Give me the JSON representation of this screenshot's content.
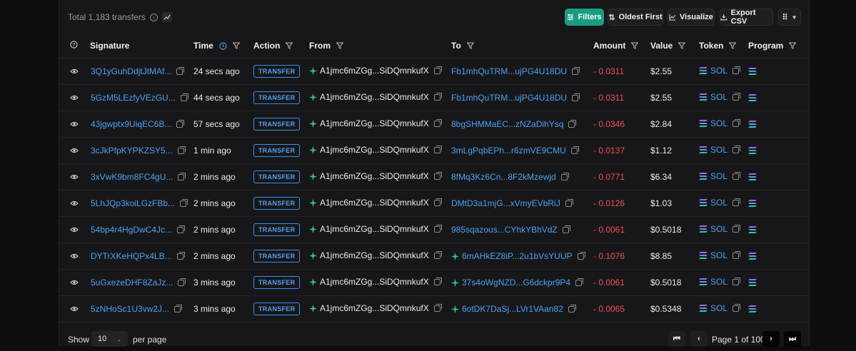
{
  "header": {
    "total_label": "Total 1,183 transfers",
    "filters_label": "Filters",
    "sort_label": "Oldest First",
    "visualize_label": "Visualize",
    "export_label": "Export CSV"
  },
  "columns": {
    "signature": "Signature",
    "time": "Time",
    "action": "Action",
    "from": "From",
    "to": "To",
    "amount": "Amount",
    "value": "Value",
    "token": "Token",
    "program": "Program"
  },
  "rows": [
    {
      "signature": "3Q1yGuhDdjtJtMAf...",
      "time": "24 secs ago",
      "action": "TRANSFER",
      "from": "A1jmc6mZGg...SiDQmnkufX",
      "to": "Fb1mhQuTRM...ujPG4U18DU",
      "to_has_icon": false,
      "amount": "- 0.0311",
      "value": "$2.55",
      "token": "SOL"
    },
    {
      "signature": "5GzM5LEzfyVEzGU...",
      "time": "44 secs ago",
      "action": "TRANSFER",
      "from": "A1jmc6mZGg...SiDQmnkufX",
      "to": "Fb1mhQuTRM...ujPG4U18DU",
      "to_has_icon": false,
      "amount": "- 0.0311",
      "value": "$2.55",
      "token": "SOL"
    },
    {
      "signature": "43jgwptx9UiqEC6B...",
      "time": "57 secs ago",
      "action": "TRANSFER",
      "from": "A1jmc6mZGg...SiDQmnkufX",
      "to": "8bgSHMMaEC...zNZaDihYsq",
      "to_has_icon": false,
      "amount": "- 0.0346",
      "value": "$2.84",
      "token": "SOL"
    },
    {
      "signature": "3cJkPfpKYPKZSY5...",
      "time": "1 min ago",
      "action": "TRANSFER",
      "from": "A1jmc6mZGg...SiDQmnkufX",
      "to": "3mLgPqbEPh...r6zmVE9CMU",
      "to_has_icon": false,
      "amount": "- 0.0137",
      "value": "$1.12",
      "token": "SOL"
    },
    {
      "signature": "3xVwK9bm8FC4gU...",
      "time": "2 mins ago",
      "action": "TRANSFER",
      "from": "A1jmc6mZGg...SiDQmnkufX",
      "to": "8fMq3Kz6Cn...8F2kMzewjd",
      "to_has_icon": false,
      "amount": "- 0.0771",
      "value": "$6.34",
      "token": "SOL"
    },
    {
      "signature": "5LhJQp3koiLGzFBb...",
      "time": "2 mins ago",
      "action": "TRANSFER",
      "from": "A1jmc6mZGg...SiDQmnkufX",
      "to": "DMtD3a1mjG...xVmyEVbRiJ",
      "to_has_icon": false,
      "amount": "- 0.0126",
      "value": "$1.03",
      "token": "SOL"
    },
    {
      "signature": "54bp4r4HgDwC4Jc...",
      "time": "2 mins ago",
      "action": "TRANSFER",
      "from": "A1jmc6mZGg...SiDQmnkufX",
      "to": "985sqazous...CYhkYBhVdZ",
      "to_has_icon": false,
      "amount": "- 0.0061",
      "value": "$0.5018",
      "token": "SOL"
    },
    {
      "signature": "DYTrXKeHQPx4LB...",
      "time": "2 mins ago",
      "action": "TRANSFER",
      "from": "A1jmc6mZGg...SiDQmnkufX",
      "to": "6mAHkEZ8iP...2u1bVsYUUP",
      "to_has_icon": true,
      "amount": "- 0.1076",
      "value": "$8.85",
      "token": "SOL"
    },
    {
      "signature": "5uGxezeDHF8ZaJz...",
      "time": "3 mins ago",
      "action": "TRANSFER",
      "from": "A1jmc6mZGg...SiDQmnkufX",
      "to": "37s4oWgNZD...G6dckpr9P4",
      "to_has_icon": true,
      "amount": "- 0.0061",
      "value": "$0.5018",
      "token": "SOL"
    },
    {
      "signature": "5zNHoSc1U3vw2J...",
      "time": "3 mins ago",
      "action": "TRANSFER",
      "from": "A1jmc6mZGg...SiDQmnkufX",
      "to": "6otDK7DaSj...LVr1VAan82",
      "to_has_icon": true,
      "amount": "- 0.0065",
      "value": "$0.5348",
      "token": "SOL"
    }
  ],
  "footer": {
    "show_label": "Show",
    "page_size": "10",
    "per_page_label": "per page",
    "page_info": "Page 1 of 100"
  },
  "colors": {
    "accent": "#1a9c82",
    "link": "#4ea1f0",
    "negative": "#f05252"
  }
}
